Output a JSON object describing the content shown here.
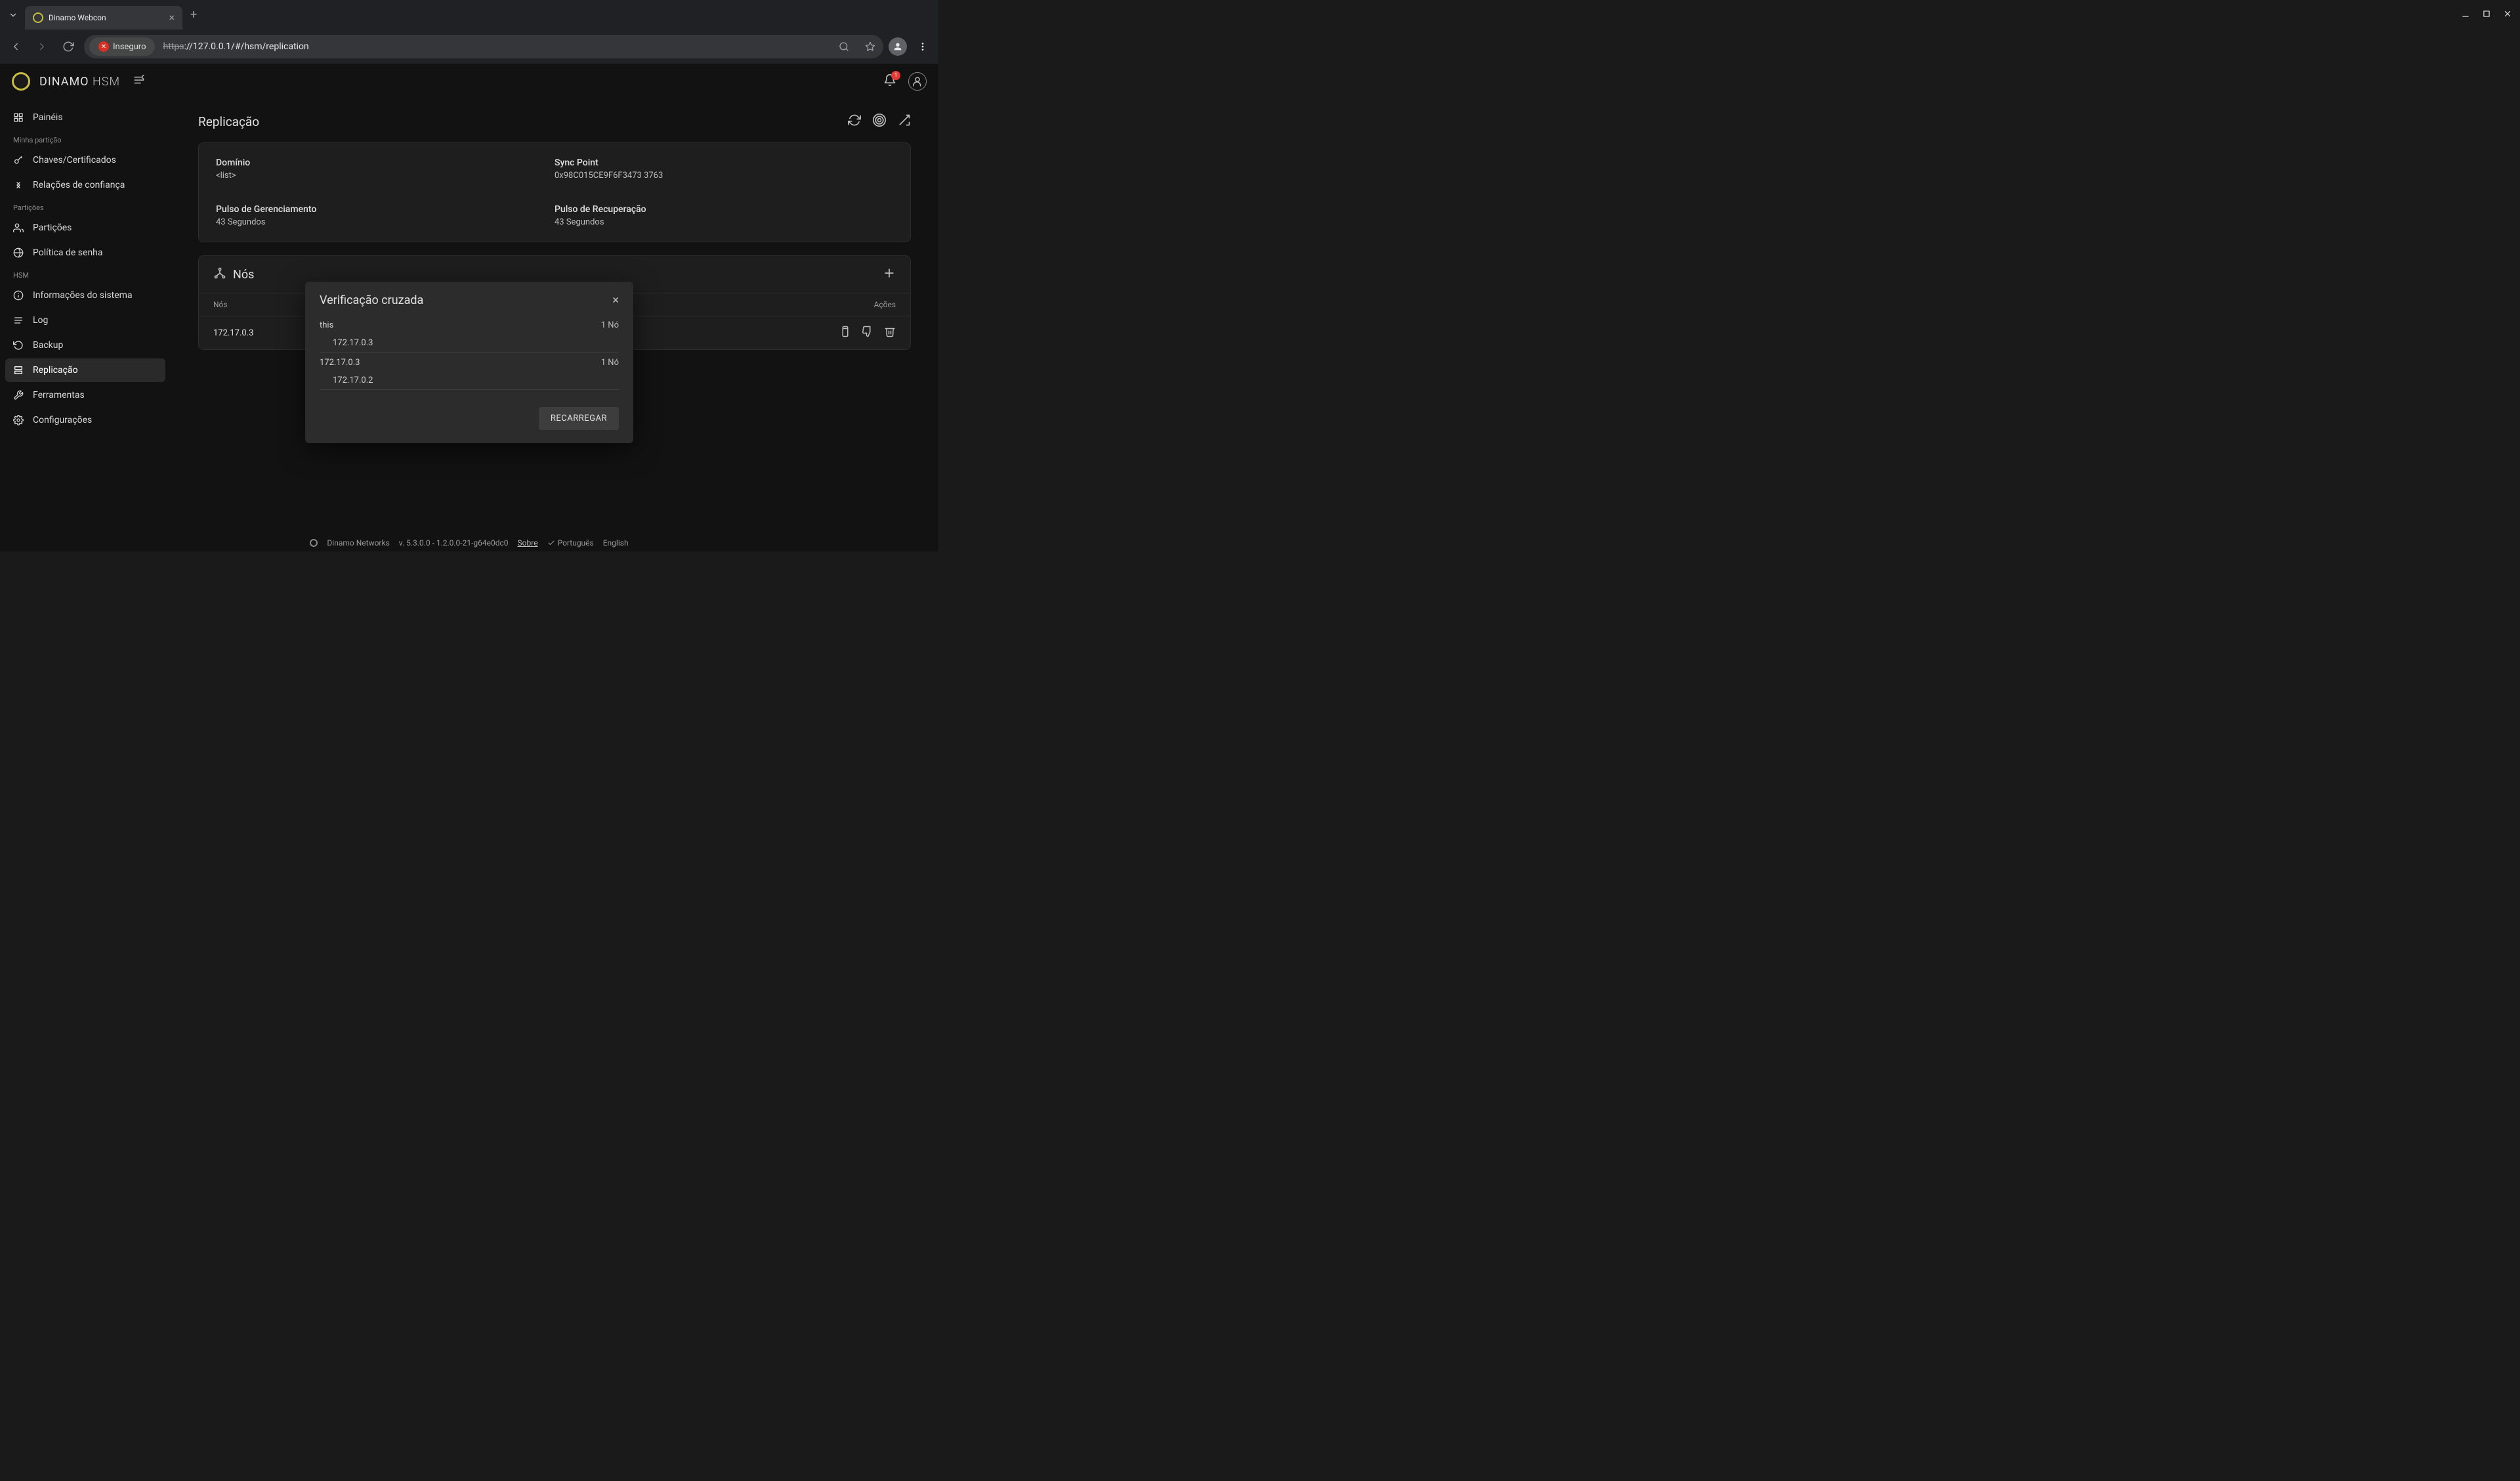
{
  "browser": {
    "tab_title": "Dinamo Webcon",
    "security_label": "Inseguro",
    "url_proto": "https",
    "url_rest": "://127.0.0.1/#/hsm/replication"
  },
  "header": {
    "title_main": "DINAMO",
    "title_sub": "HSM",
    "notification_count": "1"
  },
  "sidebar": {
    "heading_partition": "Minha partição",
    "heading_partitions": "Partições",
    "heading_hsm": "HSM",
    "items": {
      "paineis": "Painéis",
      "chaves": "Chaves/Certificados",
      "relacoes": "Relações de confiança",
      "particoes": "Partições",
      "politica": "Política de senha",
      "info": "Informações do sistema",
      "log": "Log",
      "backup": "Backup",
      "replicacao": "Replicação",
      "ferramentas": "Ferramentas",
      "configuracoes": "Configurações"
    }
  },
  "page": {
    "title": "Replicação",
    "info": {
      "dominio_label": "Domínio",
      "dominio_value": "<list>",
      "sync_label": "Sync Point",
      "sync_value": "0x98C015CE9F6F3473 3763",
      "pulso_g_label": "Pulso de Gerenciamento",
      "pulso_g_value": "43 Segundos",
      "pulso_r_label": "Pulso de Recuperação",
      "pulso_r_value": "43 Segundos"
    },
    "nodes": {
      "title": "Nós",
      "col_nos": "Nós",
      "col_acoes": "Ações",
      "row0_ip": "172.17.0.3"
    }
  },
  "modal": {
    "title": "Verificação cruzada",
    "rows": [
      {
        "host": "this",
        "count": "1 Nó",
        "sub": "172.17.0.3"
      },
      {
        "host": "172.17.0.3",
        "count": "1 Nó",
        "sub": "172.17.0.2"
      }
    ],
    "reload": "RECARREGAR"
  },
  "footer": {
    "company": "Dinamo Networks",
    "version": "v. 5.3.0.0 - 1.2.0.0-21-g64e0dc0",
    "about": "Sobre",
    "lang_pt": "Português",
    "lang_en": "English"
  }
}
